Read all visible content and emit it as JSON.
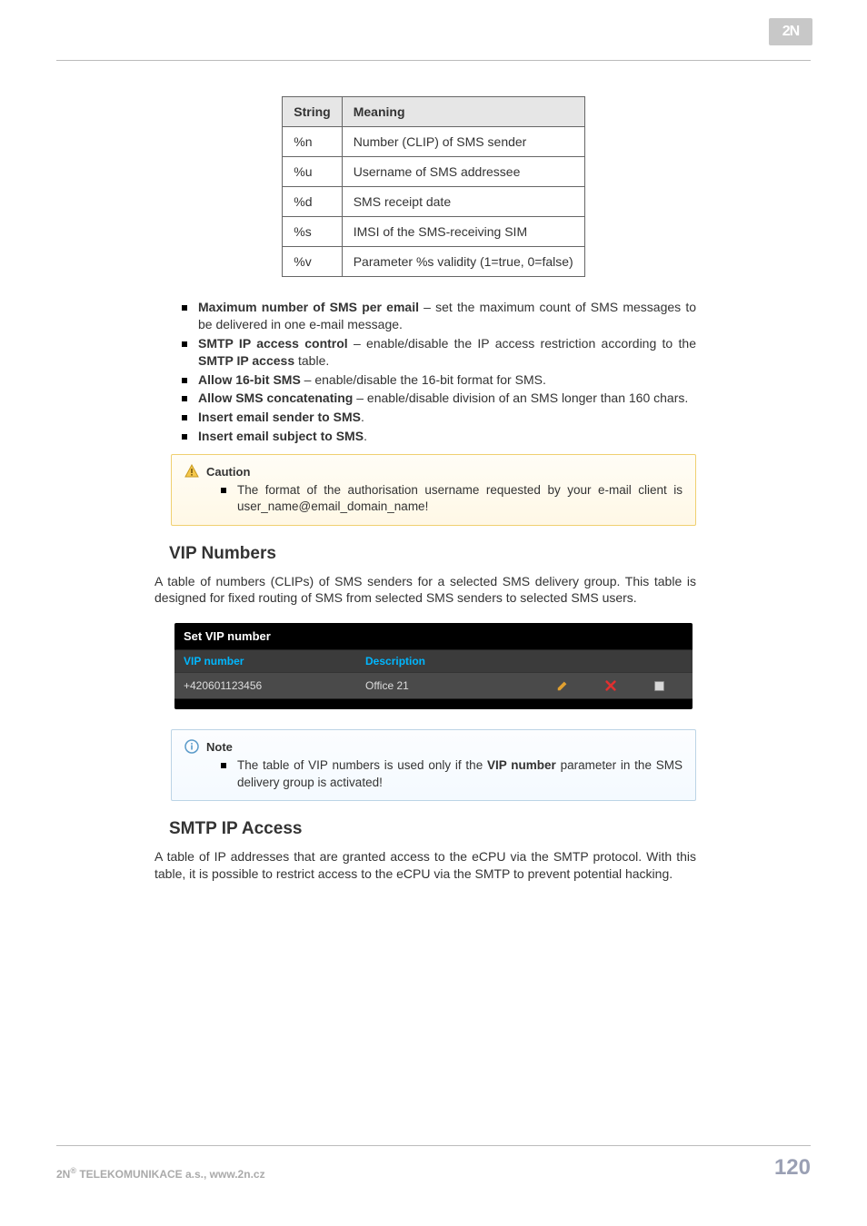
{
  "logo_text": "2N",
  "string_table": {
    "headers": {
      "col1": "String",
      "col2": "Meaning"
    },
    "rows": [
      {
        "s": "%n",
        "m": "Number (CLIP) of SMS sender"
      },
      {
        "s": "%u",
        "m": "Username of SMS addressee"
      },
      {
        "s": "%d",
        "m": "SMS receipt date"
      },
      {
        "s": "%s",
        "m": "IMSI of the SMS-receiving SIM"
      },
      {
        "s": "%v",
        "m": "Parameter %s validity (1=true, 0=false)"
      }
    ]
  },
  "bullets1": {
    "b1_strong": "Maximum number of SMS per email",
    "b1_rest": " – set the maximum count of SMS messages to be delivered in one e-mail message.",
    "b2_strong": "SMTP IP access control",
    "b2_rest_a": " – enable/disable the IP access restriction according to the ",
    "b2_rest_b": "SMTP IP access",
    "b2_rest_c": " table.",
    "b3_strong": "Allow 16-bit SMS",
    "b3_rest": " – enable/disable the 16-bit format for SMS.",
    "b4_strong": "Allow SMS concatenating",
    "b4_rest": " – enable/disable division of an SMS longer than 160 chars.",
    "b5_strong": "Insert email sender to SMS",
    "b5_rest": ".",
    "b6_strong": "Insert email subject to SMS",
    "b6_rest": "."
  },
  "caution": {
    "title": "Caution",
    "item": "The format of the authorisation username requested by your e-mail client is user_name@email_domain_name!"
  },
  "section_vip": {
    "title": "VIP Numbers",
    "para": "A table of numbers (CLIPs) of SMS senders for a selected SMS delivery group. This table is designed for fixed routing of SMS from selected SMS senders to selected SMS users."
  },
  "vip_shot": {
    "title": "Set VIP number",
    "col_num": "VIP number",
    "col_desc": "Description",
    "row_num": "+420601123456",
    "row_desc": "Office 21"
  },
  "note": {
    "title": "Note",
    "item_a": "The table of VIP numbers is used only if the ",
    "item_b": "VIP number",
    "item_c": " parameter in the SMS delivery group is activated!"
  },
  "section_smtp": {
    "title": "SMTP IP Access",
    "para": "A table of IP addresses that are granted access to the eCPU via the SMTP protocol. With this table, it is possible to restrict access to the eCPU via the SMTP to prevent potential hacking."
  },
  "footer": {
    "left_a": "2N",
    "left_sup": "®",
    "left_b": " TELEKOMUNIKACE a.s., www.2n.cz",
    "page": "120"
  }
}
